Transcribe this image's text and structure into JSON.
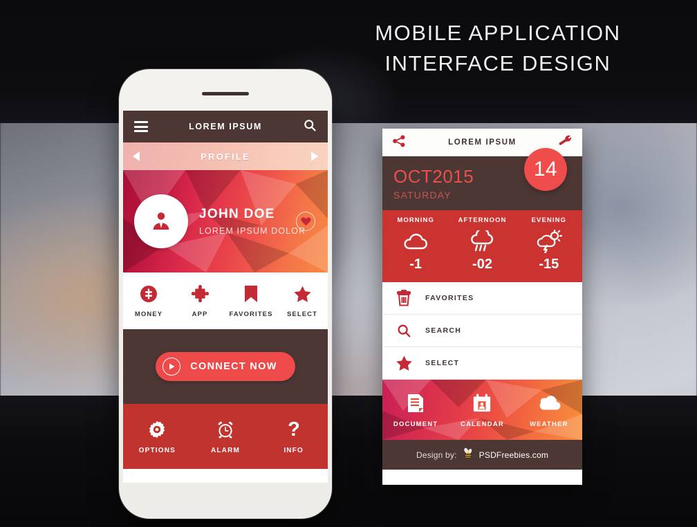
{
  "headline": {
    "line1": "MOBILE APPLICATION",
    "line2": "INTERFACE DESIGN"
  },
  "colors": {
    "dark_brown": "#4C3734",
    "red": "#C0332F",
    "bright_red": "#EF4A4A",
    "crimson": "#A60E36",
    "orange": "#F98A42",
    "pink_bar": "#EFB1AE"
  },
  "phone1": {
    "topbar": {
      "menu_icon": "hamburger-icon",
      "title": "LOREM IPSUM",
      "search_icon": "search-icon"
    },
    "profilebar": {
      "prev_icon": "triangle-left-icon",
      "label": "PROFILE",
      "next_icon": "triangle-right-icon"
    },
    "hero": {
      "avatar_icon": "user-icon",
      "name": "JOHN DOE",
      "subtitle": "LOREM IPSUM DOLOR",
      "heart_icon": "heart-icon"
    },
    "shortcuts": [
      {
        "icon": "money-icon",
        "label": "MONEY"
      },
      {
        "icon": "puzzle-icon",
        "label": "APP"
      },
      {
        "icon": "bookmark-icon",
        "label": "FAVORITES"
      },
      {
        "icon": "star-icon",
        "label": "SELECT"
      }
    ],
    "connect": {
      "icon": "play-icon",
      "label": "CONNECT NOW"
    },
    "bottom_nav": [
      {
        "icon": "gear-icon",
        "label": "OPTIONS"
      },
      {
        "icon": "alarm-clock-icon",
        "label": "ALARM"
      },
      {
        "icon": "question-mark-icon",
        "label": "INFO"
      }
    ]
  },
  "card2": {
    "topbar": {
      "share_icon": "share-icon",
      "title": "LOREM IPSUM",
      "settings_icon": "wrench-icon"
    },
    "date": {
      "month_year": "OCT2015",
      "weekday": "SATURDAY",
      "day_number": "14"
    },
    "weather": [
      {
        "label": "MORNING",
        "icon": "cloud-icon",
        "value": "-1"
      },
      {
        "label": "AFTERNOON",
        "icon": "rain-cloud-icon",
        "value": "-02"
      },
      {
        "label": "EVENING",
        "icon": "sun-lightning-icon",
        "value": "-15"
      }
    ],
    "list": [
      {
        "icon": "trash-icon",
        "label": "FAVORITES"
      },
      {
        "icon": "search-icon",
        "label": "SEARCH"
      },
      {
        "icon": "star-icon",
        "label": "SELECT"
      }
    ],
    "bottom_nav": [
      {
        "icon": "document-icon",
        "label": "DOCUMENT"
      },
      {
        "icon": "calendar-icon",
        "label": "CALENDAR"
      },
      {
        "icon": "cloud-icon",
        "label": "WEATHER"
      }
    ],
    "footer": {
      "prefix": "Design by:",
      "bee_icon": "bee-icon",
      "site": "PSDFreebies.com"
    }
  }
}
